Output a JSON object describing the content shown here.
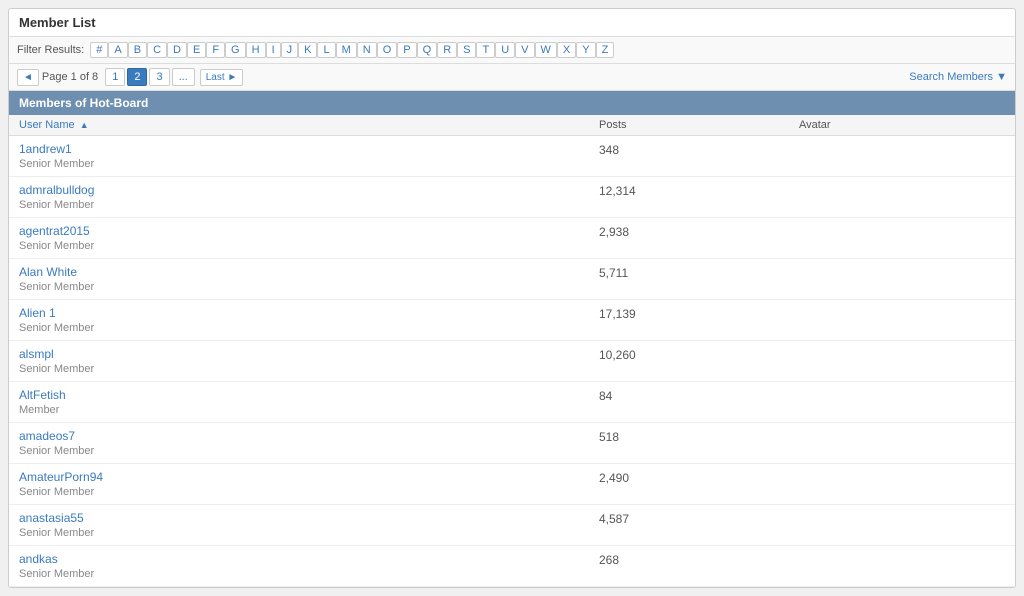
{
  "page": {
    "title": "Member List"
  },
  "filter": {
    "label": "Filter Results:",
    "letters": [
      "#",
      "A",
      "B",
      "C",
      "D",
      "E",
      "F",
      "G",
      "H",
      "I",
      "J",
      "K",
      "L",
      "M",
      "N",
      "O",
      "P",
      "Q",
      "R",
      "S",
      "T",
      "U",
      "V",
      "W",
      "X",
      "Y",
      "Z"
    ]
  },
  "pagination": {
    "prev_label": "◄",
    "page_info": "Page 1 of 8",
    "pages": [
      "1",
      "2",
      "3",
      "..."
    ],
    "last_label": "Last ►",
    "search_label": "Search Members ▼"
  },
  "section": {
    "title": "Members of Hot-Board"
  },
  "table": {
    "col_username": "User Name",
    "col_posts": "Posts",
    "col_avatar": "Avatar",
    "sort_arrow": "▲"
  },
  "members": [
    {
      "name": "1andrew1",
      "rank": "Senior Member",
      "posts": "348"
    },
    {
      "name": "admralbulldog",
      "rank": "Senior Member",
      "posts": "12,314"
    },
    {
      "name": "agentrat2015",
      "rank": "Senior Member",
      "posts": "2,938"
    },
    {
      "name": "Alan White",
      "rank": "Senior Member",
      "posts": "5,711"
    },
    {
      "name": "Alien 1",
      "rank": "Senior Member",
      "posts": "17,139"
    },
    {
      "name": "alsmpl",
      "rank": "Senior Member",
      "posts": "10,260"
    },
    {
      "name": "AltFetish",
      "rank": "Member",
      "posts": "84"
    },
    {
      "name": "amadeos7",
      "rank": "Senior Member",
      "posts": "518"
    },
    {
      "name": "AmateurPorn94",
      "rank": "Senior Member",
      "posts": "2,490"
    },
    {
      "name": "anastasia55",
      "rank": "Senior Member",
      "posts": "4,587"
    },
    {
      "name": "andkas",
      "rank": "Senior Member",
      "posts": "268"
    }
  ]
}
